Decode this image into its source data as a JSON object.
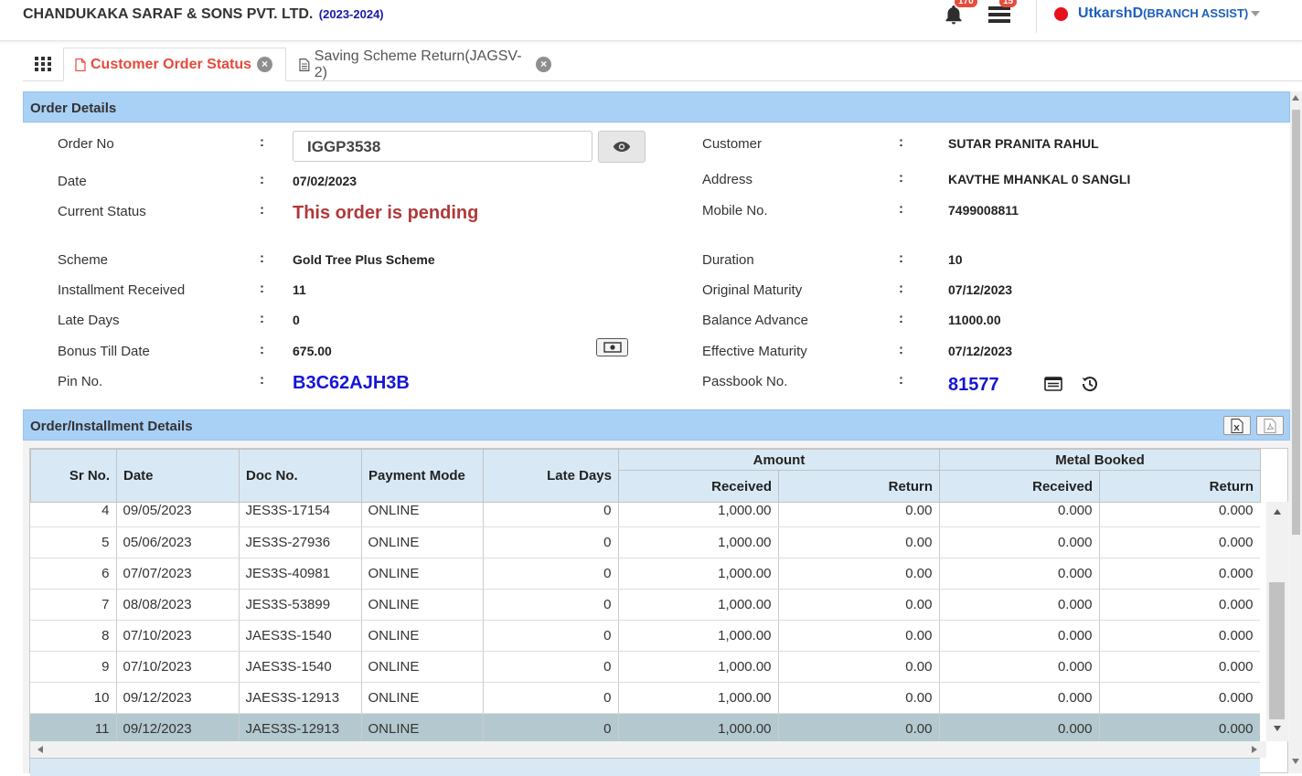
{
  "header": {
    "company": "CHANDUKAKA SARAF & SONS PVT. LTD.",
    "year": "(2023-2024)",
    "notif_count": "170",
    "tasks_count": "15",
    "user": "UtkarshD",
    "role": "(BRANCH ASSIST)"
  },
  "tabs": [
    {
      "label": "Customer Order Status",
      "active": true
    },
    {
      "label": "Saving Scheme Return(JAGSV-2)",
      "active": false
    }
  ],
  "order_details": {
    "title": "Order Details",
    "left": {
      "order_no_label": "Order No",
      "order_no": "IGGP3538",
      "date_label": "Date",
      "date": "07/02/2023",
      "status_label": "Current Status",
      "status": "This order is pending",
      "scheme_label": "Scheme",
      "scheme": "Gold Tree Plus Scheme",
      "inst_label": "Installment Received",
      "inst": "11",
      "late_label": "Late Days",
      "late": "0",
      "bonus_label": "Bonus Till Date",
      "bonus": "675.00",
      "pin_label": "Pin No.",
      "pin": "B3C62AJH3B"
    },
    "right": {
      "customer_label": "Customer",
      "customer": "SUTAR PRANITA RAHUL",
      "address_label": "Address",
      "address": "KAVTHE MHANKAL 0 SANGLI",
      "mobile_label": "Mobile No.",
      "mobile": "7499008811",
      "duration_label": "Duration",
      "duration": "10",
      "orig_label": "Original Maturity",
      "orig": "07/12/2023",
      "balance_label": "Balance Advance",
      "balance": "11000.00",
      "eff_label": "Effective Maturity",
      "eff": "07/12/2023",
      "passbook_label": "Passbook No.",
      "passbook": "81577"
    },
    "colon": ":"
  },
  "installments": {
    "title": "Order/Installment Details",
    "headers": {
      "sr": "Sr No.",
      "date": "Date",
      "doc": "Doc No.",
      "mode": "Payment Mode",
      "late": "Late Days",
      "amount": "Amount",
      "metal": "Metal Booked",
      "amt_received": "Received",
      "amt_return": "Return",
      "metal_received": "Received",
      "metal_return": "Return"
    },
    "rows": [
      {
        "sr": "4",
        "date": "09/05/2023",
        "doc": "JES3S-17154",
        "mode": "ONLINE",
        "late": "0",
        "amt_rec": "1,000.00",
        "amt_ret": "0.00",
        "met_rec": "0.000",
        "met_ret": "0.000"
      },
      {
        "sr": "5",
        "date": "05/06/2023",
        "doc": "JES3S-27936",
        "mode": "ONLINE",
        "late": "0",
        "amt_rec": "1,000.00",
        "amt_ret": "0.00",
        "met_rec": "0.000",
        "met_ret": "0.000"
      },
      {
        "sr": "6",
        "date": "07/07/2023",
        "doc": "JES3S-40981",
        "mode": "ONLINE",
        "late": "0",
        "amt_rec": "1,000.00",
        "amt_ret": "0.00",
        "met_rec": "0.000",
        "met_ret": "0.000"
      },
      {
        "sr": "7",
        "date": "08/08/2023",
        "doc": "JES3S-53899",
        "mode": "ONLINE",
        "late": "0",
        "amt_rec": "1,000.00",
        "amt_ret": "0.00",
        "met_rec": "0.000",
        "met_ret": "0.000"
      },
      {
        "sr": "8",
        "date": "07/10/2023",
        "doc": "JAES3S-1540",
        "mode": "ONLINE",
        "late": "0",
        "amt_rec": "1,000.00",
        "amt_ret": "0.00",
        "met_rec": "0.000",
        "met_ret": "0.000"
      },
      {
        "sr": "9",
        "date": "07/10/2023",
        "doc": "JAES3S-1540",
        "mode": "ONLINE",
        "late": "0",
        "amt_rec": "1,000.00",
        "amt_ret": "0.00",
        "met_rec": "0.000",
        "met_ret": "0.000"
      },
      {
        "sr": "10",
        "date": "09/12/2023",
        "doc": "JAES3S-12913",
        "mode": "ONLINE",
        "late": "0",
        "amt_rec": "1,000.00",
        "amt_ret": "0.00",
        "met_rec": "0.000",
        "met_ret": "0.000"
      },
      {
        "sr": "11",
        "date": "09/12/2023",
        "doc": "JAES3S-12913",
        "mode": "ONLINE",
        "late": "0",
        "amt_rec": "1,000.00",
        "amt_ret": "0.00",
        "met_rec": "0.000",
        "met_ret": "0.000"
      }
    ],
    "selected_row_sr": "11"
  },
  "colors": {
    "accent_red": "#e64a3b",
    "header_blue": "#a9d0f5",
    "link_blue": "#1515d6",
    "status_red": "#b0393a"
  }
}
